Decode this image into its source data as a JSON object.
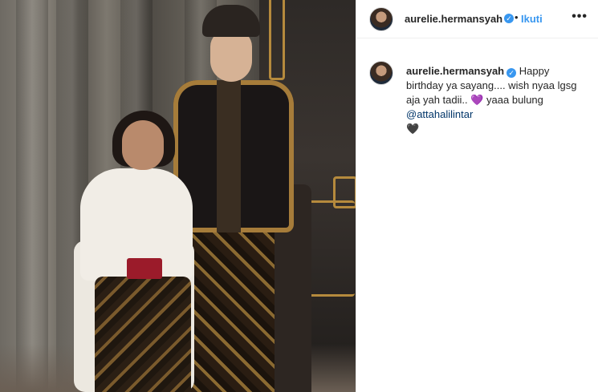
{
  "post": {
    "username": "aurelie.hermansyah",
    "dot": "•",
    "follow_label": "Ikuti",
    "more_label": "•••",
    "verified_mark": "✓"
  },
  "caption": {
    "username": "aurelie.hermansyah",
    "text_1": "Happy birthday ya sayang.... wish nyaa lgsg aja yah tadii..",
    "heart_1": "💜",
    "text_2": "yaaa bulung",
    "mention": "@attahalilintar",
    "heart_2": "🖤"
  }
}
